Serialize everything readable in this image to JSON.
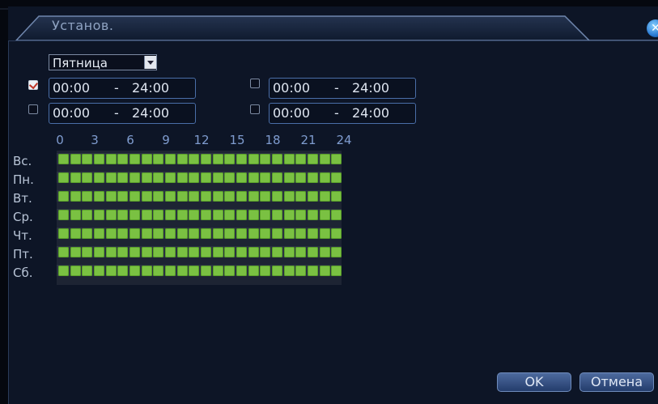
{
  "window": {
    "title": "Установ."
  },
  "day_select": {
    "value": "Пятница"
  },
  "periods": [
    {
      "checked": true,
      "start": "00:00",
      "sep": "-",
      "end": "24:00"
    },
    {
      "checked": false,
      "start": "00:00",
      "sep": "-",
      "end": "24:00"
    },
    {
      "checked": false,
      "start": "00:00",
      "sep": "-",
      "end": "24:00"
    },
    {
      "checked": false,
      "start": "00:00",
      "sep": "-",
      "end": "24:00"
    }
  ],
  "hours": [
    "0",
    "3",
    "6",
    "9",
    "12",
    "15",
    "18",
    "21",
    "24"
  ],
  "days": [
    "Вс.",
    "Пн.",
    "Вт.",
    "Ср.",
    "Чт.",
    "Пт.",
    "Сб."
  ],
  "schedule_state": "all-slots-active",
  "colors": {
    "slot_active": "#7ac142",
    "accent": "#4a6ea8"
  },
  "buttons": {
    "ok": "OK",
    "cancel": "Отмена"
  }
}
